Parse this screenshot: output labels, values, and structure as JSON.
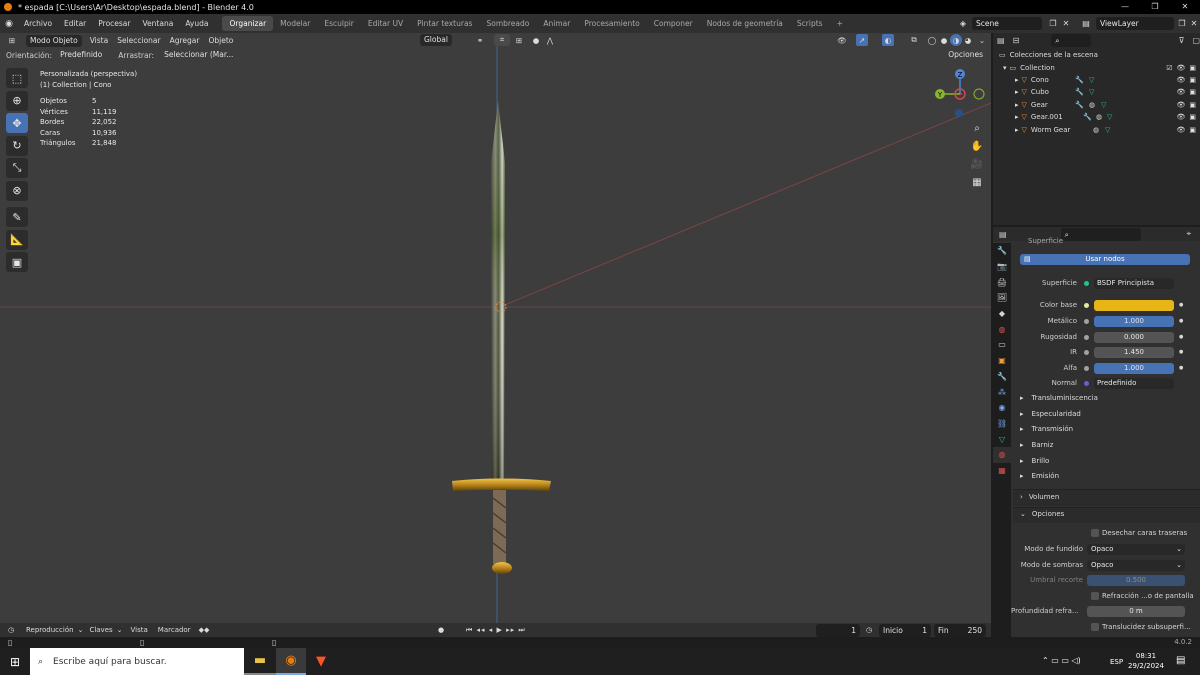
{
  "window": {
    "title": "* espada [C:\\Users\\Ar\\Desktop\\espada.blend] - Blender 4.0",
    "controls": [
      "—",
      "❐",
      "✕"
    ]
  },
  "menu": {
    "items": [
      "Archivo",
      "Editar",
      "Procesar",
      "Ventana",
      "Ayuda"
    ]
  },
  "workspaces": {
    "tabs": [
      "Organizar",
      "Modelar",
      "Esculpir",
      "Editar UV",
      "Pintar texturas",
      "Sombreado",
      "Animar",
      "Procesamiento",
      "Componer",
      "Nodos de geometría",
      "Scripts"
    ],
    "add": "+"
  },
  "scene": {
    "name": "Scene",
    "view_layer": "ViewLayer"
  },
  "viewport_header": {
    "mode": "Modo Objeto",
    "menus": [
      "Vista",
      "Seleccionar",
      "Agregar",
      "Objeto"
    ],
    "transform": "Global",
    "options": "Opciones"
  },
  "tool_header": {
    "orientation_label": "Orientación:",
    "orientation_value": "Predefinido",
    "drag_label": "Arrastrar:",
    "drag_value": "Seleccionar (Mar..."
  },
  "overlay_info": {
    "view_name": "Personalizada (perspectiva)",
    "collection": "(1) Collection | Cono"
  },
  "stats": [
    {
      "label": "Objetos",
      "value": "5"
    },
    {
      "label": "Vértices",
      "value": "11,119"
    },
    {
      "label": "Bordes",
      "value": "22,052"
    },
    {
      "label": "Caras",
      "value": "10,936"
    },
    {
      "label": "Triángulos",
      "value": "21,848"
    }
  ],
  "gizmo": {
    "z": "Z",
    "y": "Y"
  },
  "outliner": {
    "root": "Colecciones de la escena",
    "collection": "Collection",
    "items": [
      "Cono",
      "Cubo",
      "Gear",
      "Gear.001",
      "Worm Gear"
    ]
  },
  "properties": {
    "section_title": "Superficie",
    "use_nodes": "Usar nodos",
    "surface_label": "Superficie",
    "surface_value": "BSDF Principista",
    "rows": [
      {
        "label": "Color base",
        "value": "",
        "color": "#e8b517"
      },
      {
        "label": "Metálico",
        "value": "1.000",
        "color": "#4772b3"
      },
      {
        "label": "Rugosidad",
        "value": "0.000",
        "color": "#545454"
      },
      {
        "label": "IR",
        "value": "1.450",
        "color": "#545454"
      },
      {
        "label": "Alfa",
        "value": "1.000",
        "color": "#4772b3"
      }
    ],
    "normal_label": "Normal",
    "normal_value": "Predefinido",
    "subsections": [
      "Transluminiscencia",
      "Especularidad",
      "Transmisión",
      "Barniz",
      "Brillo",
      "Emisión"
    ],
    "volumen": "Volumen",
    "opciones": "Opciones",
    "backface": "Desechar caras traseras",
    "blend_label": "Modo de fundido",
    "blend_value": "Opaco",
    "shadow_label": "Modo de sombras",
    "shadow_value": "Opaco",
    "clip_label": "Umbral recorte",
    "clip_value": "0.500",
    "refraction": "Refracción ...o de pantalla",
    "depth_label": "Profundidad refra...",
    "depth_value": "0 m",
    "subsurface": "Translucidez subsuperfi..."
  },
  "timeline": {
    "menus": [
      "Reproducción",
      "Claves",
      "Vista",
      "Marcador"
    ],
    "frame": "1",
    "start_label": "Inicio",
    "start": "1",
    "end_label": "Fin",
    "end": "250"
  },
  "status": {
    "version": "4.0.2"
  },
  "taskbar": {
    "search": "Escribe aquí para buscar.",
    "lang": "ESP",
    "time": "08:31",
    "date": "29/2/2024"
  }
}
